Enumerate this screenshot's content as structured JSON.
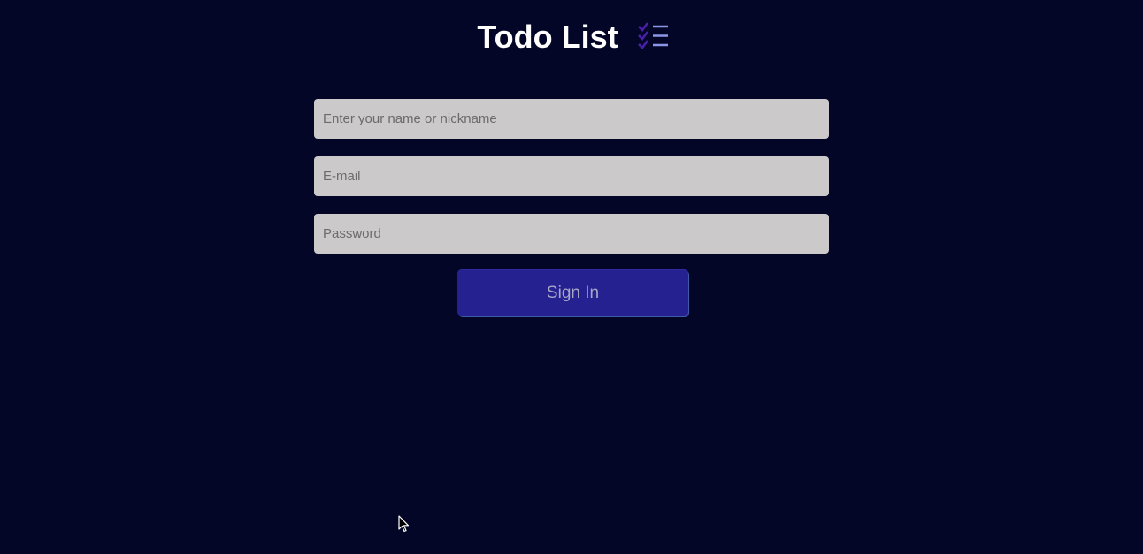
{
  "header": {
    "title": "Todo List",
    "logo_icon": "checklist-icon"
  },
  "form": {
    "name_placeholder": "Enter your name or nickname",
    "email_placeholder": "E-mail",
    "password_placeholder": "Password",
    "name_value": "",
    "email_value": "",
    "password_value": "",
    "signin_label": "Sign In"
  },
  "colors": {
    "background": "#030627",
    "field_background": "#cbc9c9",
    "button_background": "#262190",
    "button_text": "#a6a6c6",
    "icon_check": "#4a1fa8",
    "icon_lines": "#8b97e6"
  },
  "cursor_icon": "mouse-pointer-icon"
}
